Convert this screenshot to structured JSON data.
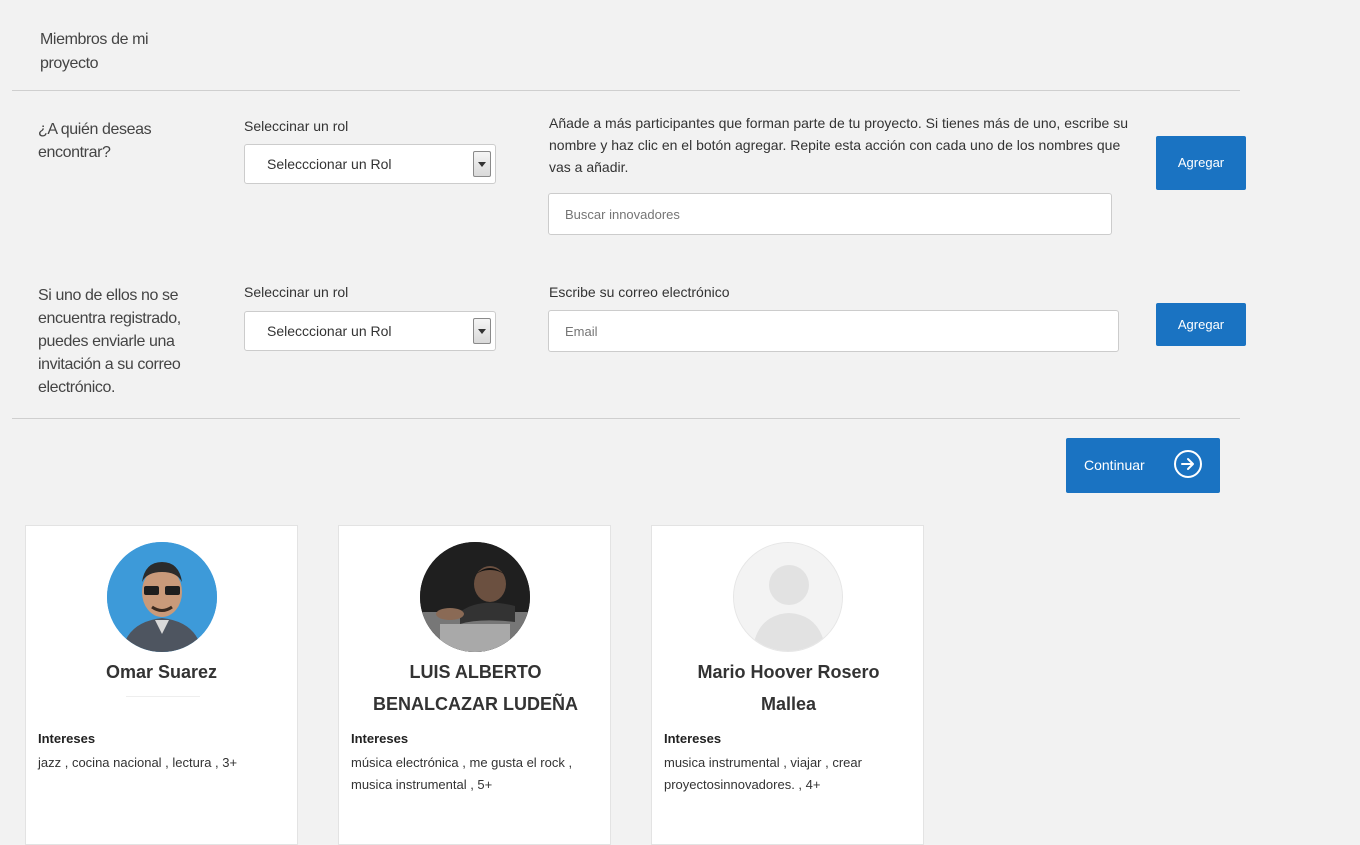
{
  "section": {
    "title": "Miembros de mi proyecto"
  },
  "search_row": {
    "question": "¿A quién deseas encontrar?",
    "role_label": "Seleccinar un rol",
    "role_value": "Selecccionar un Rol",
    "help_text": "Añade a más participantes que forman parte de tu proyecto. Si tienes más de uno, escribe su nombre y haz clic en el botón agregar. Repite esta acción con cada uno de los nombres que vas a añadir.",
    "search_placeholder": "Buscar innovadores",
    "add_label": "Agregar"
  },
  "invite_row": {
    "question": "Si uno de ellos no se encuentra registrado, puedes enviarle una invitación a su correo electrónico.",
    "role_label": "Seleccinar un rol",
    "role_value": "Selecccionar un Rol",
    "email_label": "Escribe su correo electrónico",
    "email_placeholder": "Email",
    "add_label": "Agregar"
  },
  "continue_label": "Continuar",
  "members": [
    {
      "name": "Omar Suarez",
      "interests_label": "Intereses",
      "interests": "jazz , cocina nacional , lectura , 3+"
    },
    {
      "name": "LUIS ALBERTO BENALCAZAR LUDEÑA",
      "interests_label": "Intereses",
      "interests": "música electrónica , me gusta el rock , musica instrumental , 5+"
    },
    {
      "name": "Mario Hoover Rosero Mallea",
      "interests_label": "Intereses",
      "interests": "musica instrumental , viajar , crear proyectosinnovadores. , 4+"
    }
  ],
  "colors": {
    "primary": "#1a73c2",
    "background": "#f2f2f2",
    "card": "#ffffff"
  }
}
